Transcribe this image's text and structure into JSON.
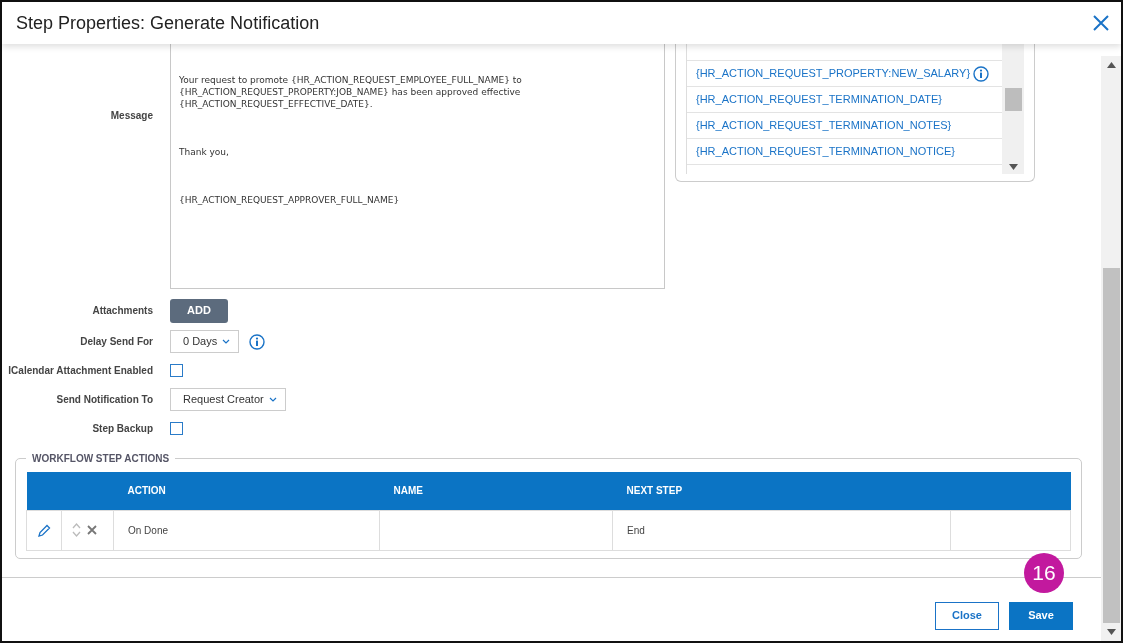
{
  "dialog": {
    "title": "Step Properties: Generate Notification"
  },
  "message": {
    "label": "Message",
    "paragraphs": [
      [
        "Your request to promote {HR_ACTION_REQUEST_EMPLOYEE_FULL_NAME} to",
        "{HR_ACTION_REQUEST_PROPERTY:JOB_NAME} has been approved effective",
        "{HR_ACTION_REQUEST_EFFECTIVE_DATE}."
      ],
      [
        "Thank you,"
      ],
      [
        "{HR_ACTION_REQUEST_APPROVER_FULL_NAME}"
      ]
    ]
  },
  "tokens": [
    {
      "text": "{HR_ACTION_REQUEST_PROPERTY:NEW_SALARY}",
      "info": true
    },
    {
      "text": "{HR_ACTION_REQUEST_TERMINATION_DATE}",
      "info": false
    },
    {
      "text": "{HR_ACTION_REQUEST_TERMINATION_NOTES}",
      "info": false
    },
    {
      "text": "{HR_ACTION_REQUEST_TERMINATION_NOTICE}",
      "info": false
    }
  ],
  "fields": [
    {
      "kind": "button",
      "label": "Attachments",
      "value": "ADD"
    },
    {
      "kind": "dropdown",
      "label": "Delay Send For",
      "value": "0 Days",
      "info": true
    },
    {
      "kind": "checkbox",
      "label": "ICalendar Attachment Enabled",
      "checked": false
    },
    {
      "kind": "dropdown",
      "label": "Send Notification To",
      "value": "Request Creator",
      "info": false
    },
    {
      "kind": "checkbox",
      "label": "Step Backup",
      "checked": false
    }
  ],
  "actions": {
    "legend": "WORKFLOW STEP ACTIONS",
    "columns": [
      "ACTION",
      "NAME",
      "NEXT STEP"
    ],
    "rows": [
      {
        "action": "On Done",
        "next_step": "End"
      }
    ]
  },
  "footer": {
    "buttons": [
      {
        "label": "Close",
        "kind": "secondary"
      },
      {
        "label": "Save",
        "kind": "primary"
      }
    ]
  },
  "callout": "16"
}
